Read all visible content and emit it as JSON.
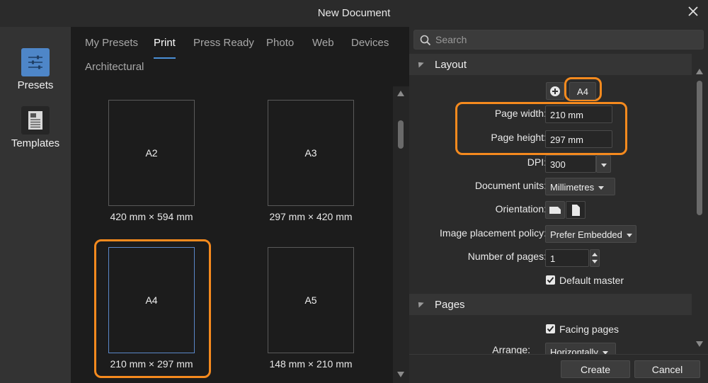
{
  "window": {
    "title": "New Document"
  },
  "sidebar": {
    "items": [
      {
        "label": "Presets",
        "icon": "presets-icon",
        "active": true
      },
      {
        "label": "Templates",
        "icon": "templates-icon",
        "active": false
      }
    ]
  },
  "tabs": {
    "items": [
      "My Presets",
      "Print",
      "Press Ready",
      "Photo",
      "Web",
      "Devices",
      "Architectural"
    ],
    "active": "Print"
  },
  "presets": [
    {
      "name": "A2",
      "size": "420 mm × 594 mm"
    },
    {
      "name": "A3",
      "size": "297 mm × 420 mm"
    },
    {
      "name": "A4",
      "size": "210 mm × 297 mm",
      "selected": true
    },
    {
      "name": "A5",
      "size": "148 mm × 210 mm"
    }
  ],
  "search": {
    "placeholder": "Search",
    "value": ""
  },
  "layout": {
    "heading": "Layout",
    "preset_name": "A4",
    "page_width_label": "Page width:",
    "page_width": "210 mm",
    "page_height_label": "Page height:",
    "page_height": "297 mm",
    "dpi_label": "DPI:",
    "dpi": "300",
    "units_label": "Document units:",
    "units": "Millimetres",
    "orientation_label": "Orientation:",
    "placement_label": "Image placement policy:",
    "placement": "Prefer Embedded",
    "pages_label": "Number of pages:",
    "pages": "1",
    "default_master_label": "Default master",
    "default_master": true
  },
  "pages": {
    "heading": "Pages",
    "facing_pages_label": "Facing pages",
    "facing_pages": true,
    "arrange_label": "Arrange:",
    "arrange": "Horizontally"
  },
  "footer": {
    "create_label": "Create",
    "cancel_label": "Cancel"
  },
  "colors": {
    "highlight": "#f58a1e",
    "accent": "#4a8fd6",
    "selection": "#5b88c9"
  }
}
